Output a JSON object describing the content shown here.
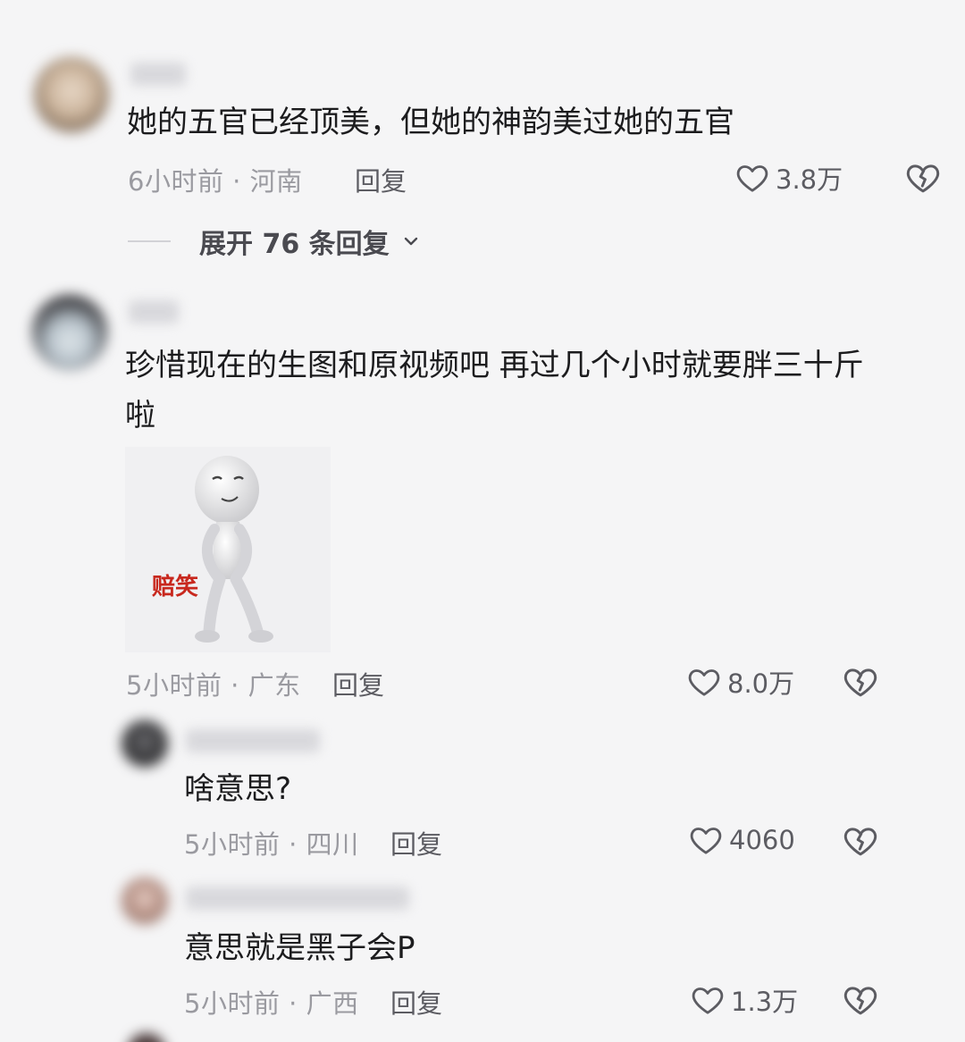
{
  "comments": [
    {
      "text": "她的五官已经顶美，但她的神韵美过她的五官",
      "meta": "6小时前 · 河南",
      "reply_label": "回复",
      "likes": "3.8万",
      "expand_label": "展开 76 条回复"
    },
    {
      "text_line1": "珍惜现在的生图和原视频吧 再过几个小时就要胖三十斤",
      "text_line2": "啦",
      "sticker_caption": "赔笑",
      "meta": "5小时前 · 广东",
      "reply_label": "回复",
      "likes": "8.0万"
    }
  ],
  "replies": [
    {
      "text": "啥意思?",
      "meta": "5小时前 · 四川",
      "reply_label": "回复",
      "likes": "4060"
    },
    {
      "text": "意思就是黑子会P",
      "meta": "5小时前 · 广西",
      "reply_label": "回复",
      "likes": "1.3万"
    }
  ],
  "icons": {
    "like": "heart-outline-icon",
    "dislike": "broken-heart-icon",
    "expand": "chevron-down-icon"
  },
  "colors": {
    "background": "#f5f5f6",
    "text": "#1c1c1e",
    "meta": "#9a9aa0",
    "action": "#5c5c62",
    "sticker_caption": "#c8281e"
  }
}
